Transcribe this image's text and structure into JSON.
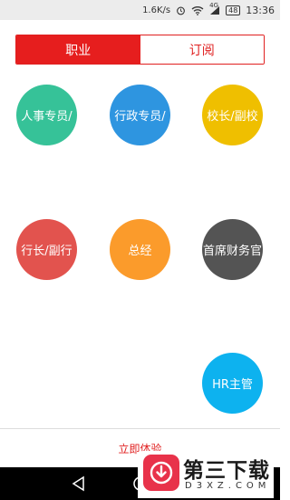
{
  "status_bar": {
    "speed": "1.6K/s",
    "battery": "48",
    "time": "13:36",
    "signal_label": "4G"
  },
  "tabs": [
    {
      "label": "职业",
      "active": true
    },
    {
      "label": "订阅",
      "active": false
    }
  ],
  "positions": [
    {
      "label": "人事专员/",
      "color": "#36c298"
    },
    {
      "label": "行政专员/",
      "color": "#2e95e0"
    },
    {
      "label": "校长/副校",
      "color": "#efbf00"
    },
    {
      "label": "行长/副行",
      "color": "#e2534e"
    },
    {
      "label": "总经",
      "color": "#fb9b2b"
    },
    {
      "label": "首席财务官",
      "color": "#545454"
    },
    {
      "label": "HR主管",
      "color": "#0db2ef"
    }
  ],
  "cta": {
    "label": "立即体验"
  },
  "watermark": {
    "title": "第三下载",
    "sub": "D3XZ.COM"
  }
}
